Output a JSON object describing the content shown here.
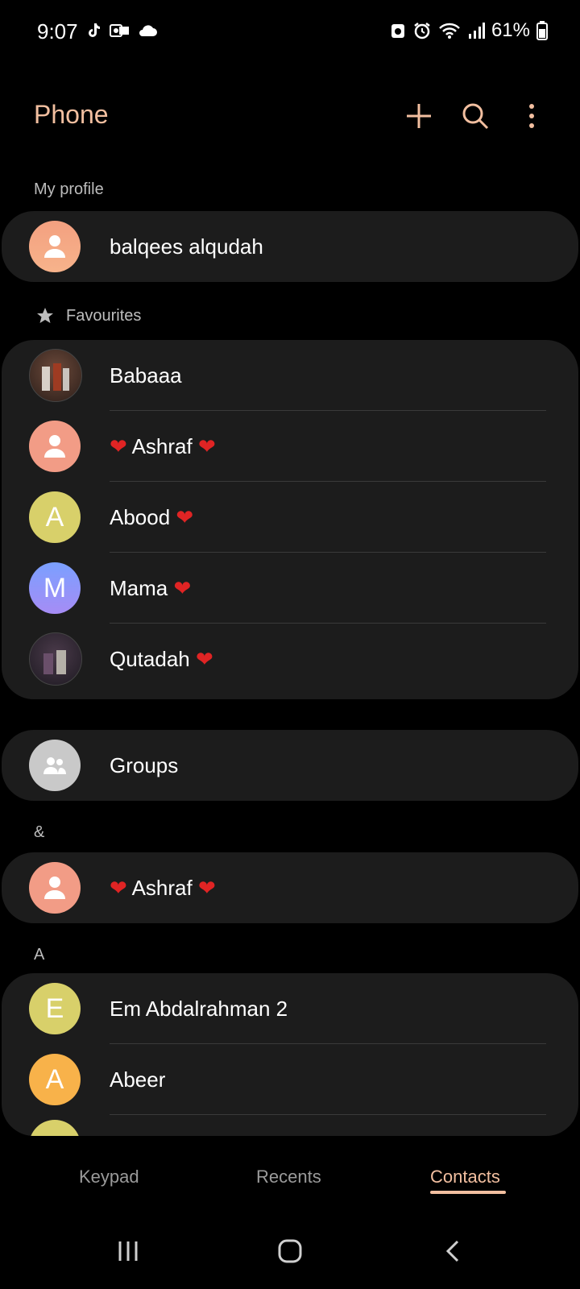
{
  "status": {
    "time": "9:07",
    "battery": "61%"
  },
  "app": {
    "title": "Phone"
  },
  "sections": {
    "my_profile": "My profile",
    "favourites": "Favourites",
    "amp": "&",
    "a": "A"
  },
  "profile": {
    "name": "balqees alqudah"
  },
  "favourites": [
    {
      "name": "Babaaa",
      "avatar": "photo",
      "initial": ""
    },
    {
      "name": "Ashraf",
      "avatar": "person",
      "initial": ""
    },
    {
      "name": "Abood",
      "avatar": "letter",
      "initial": "A"
    },
    {
      "name": "Mama",
      "avatar": "letter",
      "initial": "M"
    },
    {
      "name": "Qutadah",
      "avatar": "photo",
      "initial": ""
    }
  ],
  "groups": {
    "label": "Groups"
  },
  "amp_contacts": [
    {
      "name": "Ashraf"
    }
  ],
  "a_contacts": [
    {
      "name": "Em Abdalrahman 2",
      "initial": "E"
    },
    {
      "name": "Abeer",
      "initial": "A"
    }
  ],
  "tabs": {
    "keypad": "Keypad",
    "recents": "Recents",
    "contacts": "Contacts"
  },
  "colors": {
    "accent": "#f2bfa0",
    "heart": "#e02424"
  }
}
